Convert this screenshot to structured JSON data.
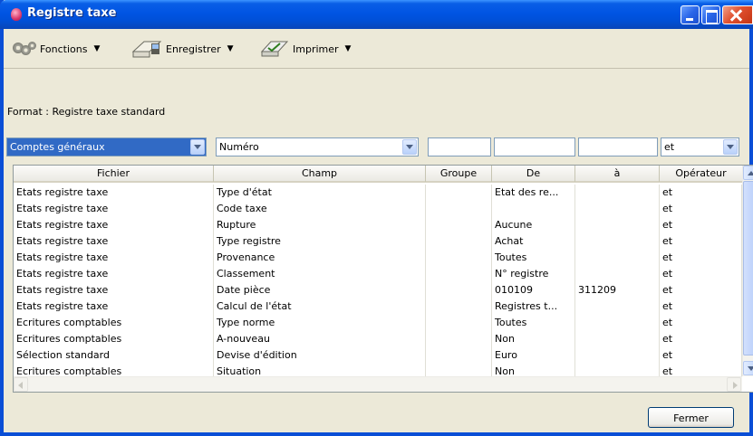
{
  "window": {
    "title": "Registre taxe"
  },
  "toolbar": {
    "fonctions_label": "Fonctions",
    "enregistrer_label": "Enregistrer",
    "imprimer_label": "Imprimer"
  },
  "format_label": "Format : Registre taxe standard",
  "filters": {
    "fichier": "Comptes généraux",
    "champ": "Numéro",
    "groupe": "",
    "de": "",
    "a": "",
    "operateur": "et"
  },
  "grid": {
    "columns": [
      "Fichier",
      "Champ",
      "Groupe",
      "De",
      "à",
      "Opérateur"
    ],
    "rows": [
      [
        "Etats registre taxe",
        "Type d'état",
        "",
        "Etat des re...",
        "",
        "et"
      ],
      [
        "Etats registre taxe",
        "Code taxe",
        "",
        "",
        "",
        "et"
      ],
      [
        "Etats registre taxe",
        "Rupture",
        "",
        "Aucune",
        "",
        "et"
      ],
      [
        "Etats registre taxe",
        "Type registre",
        "",
        "Achat",
        "",
        "et"
      ],
      [
        "Etats registre taxe",
        "Provenance",
        "",
        "Toutes",
        "",
        "et"
      ],
      [
        "Etats registre taxe",
        "Classement",
        "",
        "N° registre",
        "",
        "et"
      ],
      [
        "Etats registre taxe",
        "Date pièce",
        "",
        "010109",
        "311209",
        "et"
      ],
      [
        "Etats registre taxe",
        "Calcul de l'état",
        "",
        "Registres t...",
        "",
        "et"
      ],
      [
        "Ecritures comptables",
        "Type norme",
        "",
        "Toutes",
        "",
        "et"
      ],
      [
        "Ecritures comptables",
        "A-nouveau",
        "",
        "Non",
        "",
        "et"
      ],
      [
        "Sélection standard",
        "Devise d'édition",
        "",
        "Euro",
        "",
        "et"
      ],
      [
        "Ecritures comptables",
        "Situation",
        "",
        "Non",
        "",
        "et"
      ]
    ]
  },
  "buttons": {
    "close_label": "Fermer"
  },
  "colors": {
    "titlebar": "#0054e3",
    "selection": "#316ac5",
    "window_bg": "#ece9d8"
  }
}
